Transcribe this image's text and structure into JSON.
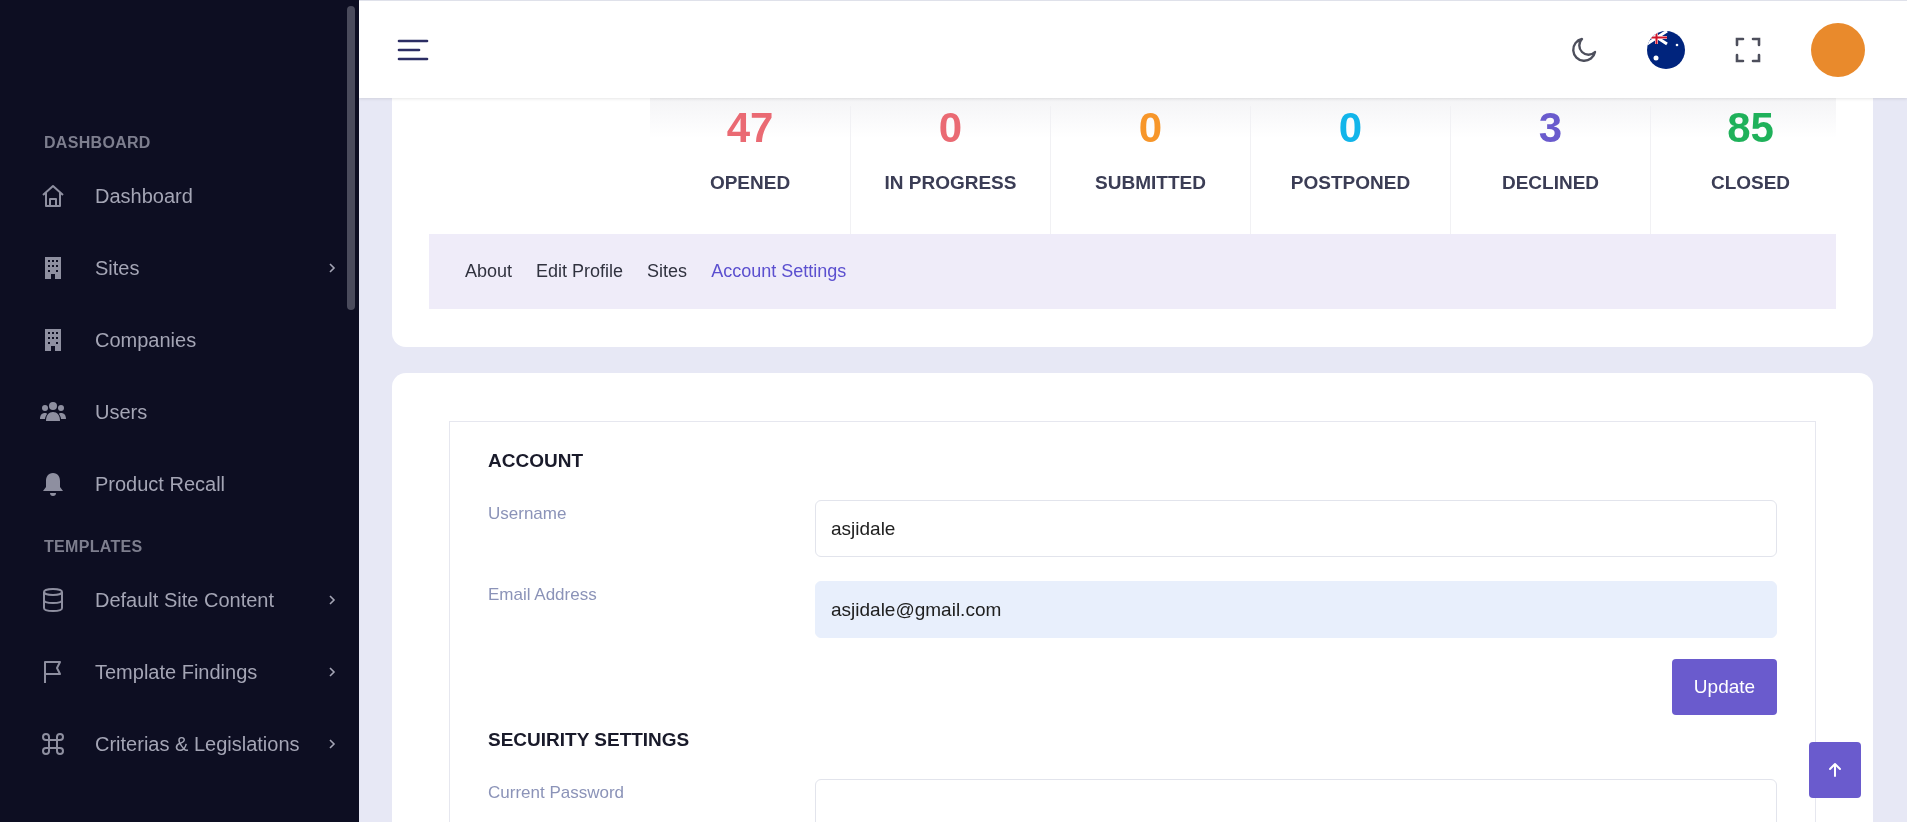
{
  "sidebar": {
    "sections": [
      {
        "title": "DASHBOARD",
        "items": [
          {
            "label": "Dashboard",
            "kind": "home",
            "expandable": false
          },
          {
            "label": "Sites",
            "kind": "building",
            "expandable": true
          },
          {
            "label": "Companies",
            "kind": "building",
            "expandable": false
          },
          {
            "label": "Users",
            "kind": "users",
            "expandable": false
          },
          {
            "label": "Product Recall",
            "kind": "bell",
            "expandable": false
          }
        ]
      },
      {
        "title": "TEMPLATES",
        "items": [
          {
            "label": "Default Site Content",
            "kind": "database",
            "expandable": true
          },
          {
            "label": "Template Findings",
            "kind": "flag",
            "expandable": true
          },
          {
            "label": "Criterias & Legislations",
            "kind": "command",
            "expandable": true
          }
        ]
      }
    ]
  },
  "stats": [
    {
      "value": "47",
      "label": "OPENED",
      "color": "#ea6a73"
    },
    {
      "value": "0",
      "label": "IN PROGRESS",
      "color": "#ea6a73"
    },
    {
      "value": "0",
      "label": "SUBMITTED",
      "color": "#f7962a"
    },
    {
      "value": "0",
      "label": "POSTPONED",
      "color": "#12b5ea"
    },
    {
      "value": "3",
      "label": "DECLINED",
      "color": "#6a5bcd"
    },
    {
      "value": "85",
      "label": "CLOSED",
      "color": "#1fb15a"
    }
  ],
  "tabs": [
    {
      "label": "About",
      "selected": false
    },
    {
      "label": "Edit Profile",
      "selected": false
    },
    {
      "label": "Sites",
      "selected": false
    },
    {
      "label": "Account Settings",
      "selected": true
    }
  ],
  "account": {
    "title": "ACCOUNT",
    "fields": [
      {
        "label": "Username",
        "value": "asjidale",
        "focused": false
      },
      {
        "label": "Email Address",
        "value": "asjidale@gmail.com",
        "focused": true
      }
    ],
    "button": "Update"
  },
  "security": {
    "title": "SECUIRITY SETTINGS",
    "fields": [
      {
        "label": "Current Password",
        "focused": false
      }
    ]
  }
}
